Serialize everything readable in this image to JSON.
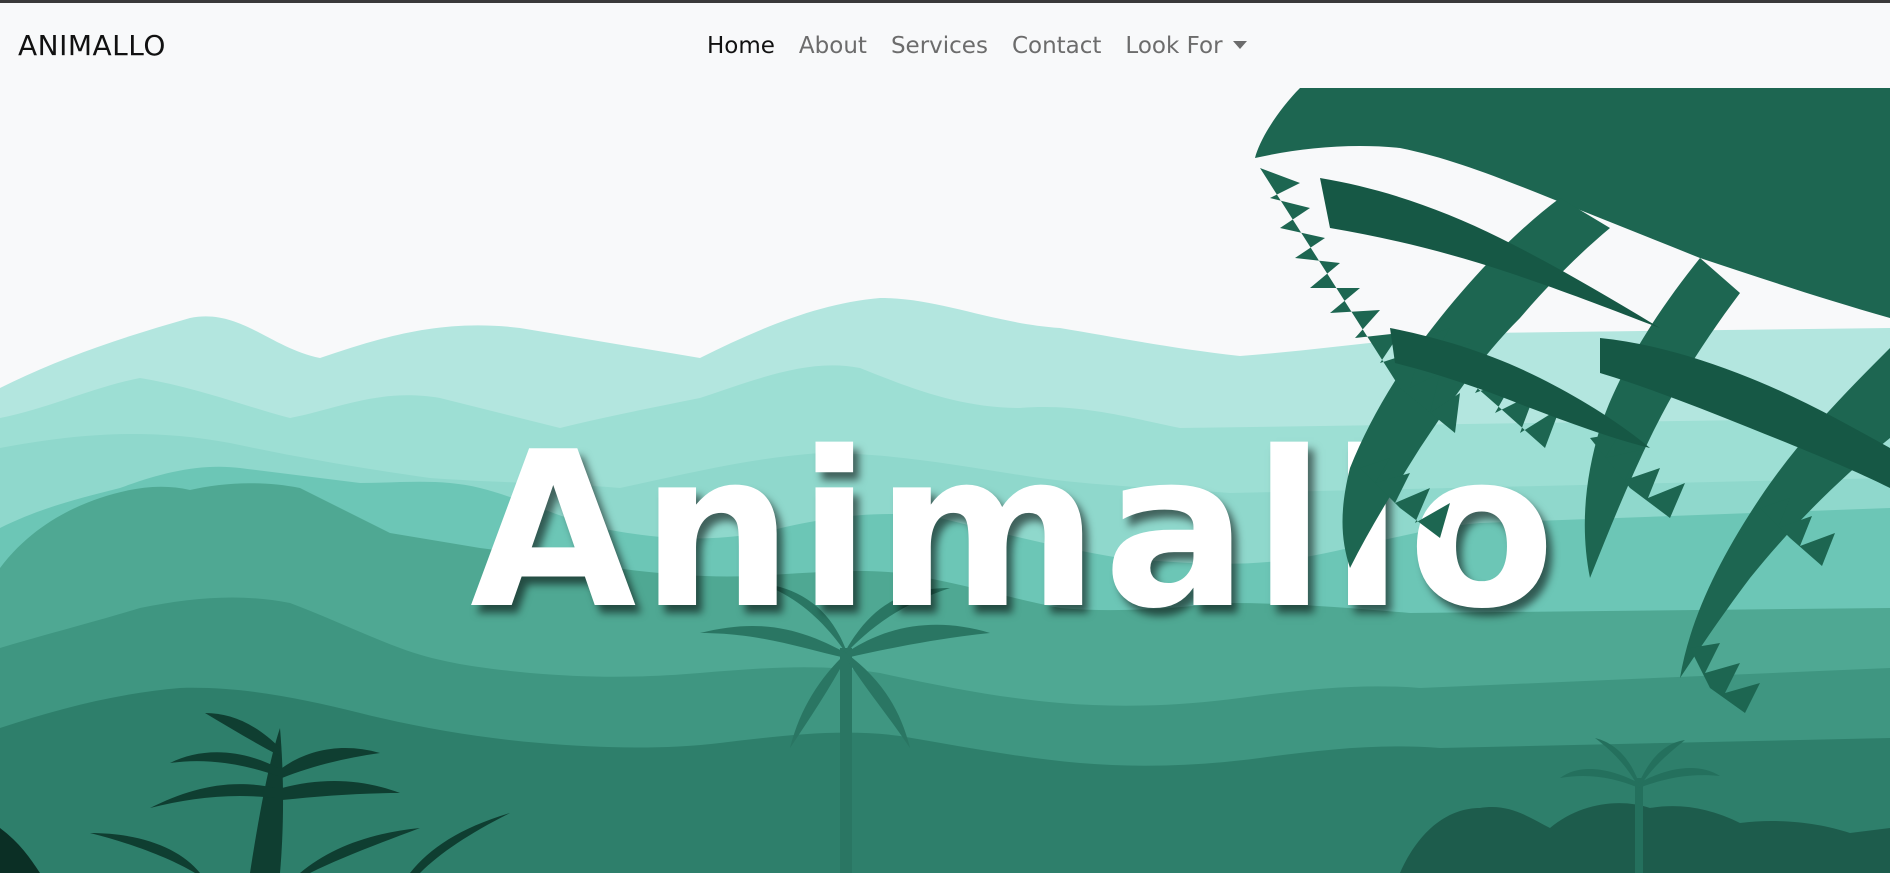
{
  "navbar": {
    "brand": "ANIMALLO",
    "links": [
      {
        "label": "Home",
        "active": true
      },
      {
        "label": "About",
        "active": false
      },
      {
        "label": "Services",
        "active": false
      },
      {
        "label": "Contact",
        "active": false
      },
      {
        "label": "Look For",
        "active": false,
        "dropdown": true
      }
    ]
  },
  "hero": {
    "title": "Animallo",
    "illustration": "jungle-landscape-illustration"
  },
  "colors": {
    "navbar_bg": "#f8f9fa",
    "sky": "#f8f9fa",
    "mountain_far": "#b3e6df",
    "mountain_mid": "#8fd8cc",
    "jungle_mid": "#4fa893",
    "jungle_dark": "#2e7f6b",
    "fern": "#1d6651",
    "fern_dark": "#0f3e31",
    "title_text": "#ffffff"
  }
}
